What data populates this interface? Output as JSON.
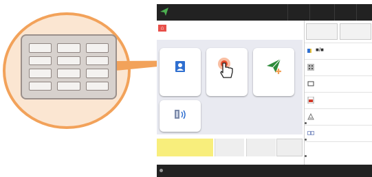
{
  "callout": {
    "keypad_rows": 4,
    "keypad_cols": 3
  },
  "topbar": {
    "back_icon": "paper-plane-back-icon"
  },
  "home": {
    "label": "⌂"
  },
  "tiles": [
    {
      "name": "address-book-tile",
      "icon": "address-book-icon"
    },
    {
      "name": "touch-button-tile",
      "icon": "hand-pointer-icon"
    },
    {
      "name": "send-tile",
      "icon": "paper-plane-icon"
    },
    {
      "name": "scan-tile",
      "icon": "scanner-waves-icon"
    }
  ],
  "right_panel": {
    "rows": [
      {
        "icon": "color-mode-icon",
        "label": "■/■"
      },
      {
        "icon": "resolution-icon",
        "label": ""
      },
      {
        "icon": "original-size-icon",
        "label": ""
      },
      {
        "icon": "file-format-icon",
        "label": ""
      },
      {
        "icon": "density-icon",
        "label": ""
      },
      {
        "icon": "duplex-icon",
        "label": ""
      }
    ]
  },
  "colors": {
    "accent_orange": "#f2a25a",
    "yellow_button": "#f8ee7c",
    "dark_bar": "#222222",
    "panel_bg": "#e9eaf1"
  }
}
